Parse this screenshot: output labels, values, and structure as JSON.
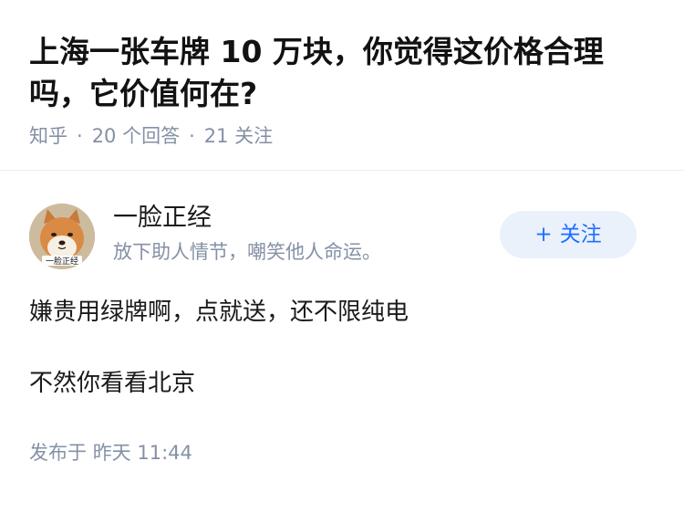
{
  "question": {
    "title": "上海一张车牌 10 万块，你觉得这价格合理吗，它价值何在?",
    "source": "知乎",
    "answer_count": "20 个回答",
    "follower_count": "21 关注"
  },
  "answer": {
    "author": {
      "name": "一脸正经",
      "bio": "放下助人情节，嘲笑他人命运。",
      "avatar_icon": "shiba-dog-avatar",
      "avatar_caption": "一脸正经"
    },
    "follow_button": {
      "plus": "+",
      "label": "关注",
      "color": "#1e6fff",
      "bg": "#eaf1fb"
    },
    "paragraphs": [
      "嫌贵用绿牌啊，点就送，还不限纯电",
      "不然你看看北京"
    ],
    "time_label": "发布于",
    "time_value": "昨天 11:44"
  },
  "colors": {
    "meta": "#8590a6",
    "text": "#1a1a1a",
    "divider": "#ececec"
  }
}
